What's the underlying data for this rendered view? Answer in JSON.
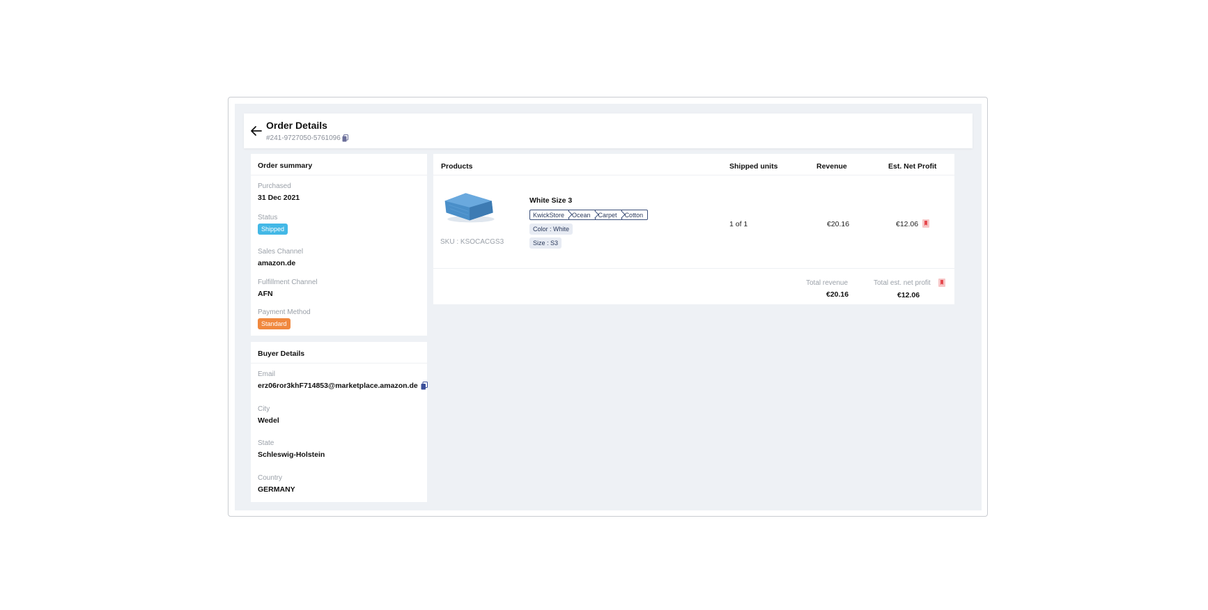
{
  "header": {
    "title": "Order Details",
    "order_id": "#241-9727050-5761096"
  },
  "order_summary": {
    "title": "Order summary",
    "purchased_label": "Purchased",
    "purchased_value": "31 Dec 2021",
    "status_label": "Status",
    "status_value": "Shipped",
    "sales_channel_label": "Sales Channel",
    "sales_channel_value": "amazon.de",
    "fulfillment_label": "Fulfillment Channel",
    "fulfillment_value": "AFN",
    "payment_label": "Payment Method",
    "payment_value": "Standard"
  },
  "buyer": {
    "title": "Buyer Details",
    "email_label": "Email",
    "email_value": "erz06ror3khF714853@marketplace.amazon.de",
    "city_label": "City",
    "city_value": "Wedel",
    "state_label": "State",
    "state_value": "Schleswig-Holstein",
    "country_label": "Country",
    "country_value": "GERMANY"
  },
  "products": {
    "headers": {
      "products": "Products",
      "shipped": "Shipped units",
      "revenue": "Revenue",
      "profit": "Est. Net Profit"
    },
    "items": [
      {
        "name": "White Size 3",
        "sku": "SKU : KSOCACGS3",
        "categories": [
          "KwickStore",
          "Ocean",
          "Carpet",
          "Cotton"
        ],
        "color": "Color : White",
        "size": "Size : S3",
        "shipped": "1 of 1",
        "revenue": "€20.16",
        "profit": "€12.06"
      }
    ],
    "total_revenue_label": "Total revenue",
    "total_revenue_value": "€20.16",
    "total_profit_label": "Total est. net profit",
    "total_profit_value": "€12.06"
  },
  "colors": {
    "status_shipped": "#43b8e6",
    "payment_standard": "#f0883e",
    "bookmark_red": "#e5484d",
    "background": "#eef1f5"
  },
  "icons": {
    "back": "arrow-left-icon",
    "copy": "copy-icon",
    "bookmark": "bookmark-icon",
    "product_image": "towel-image"
  }
}
